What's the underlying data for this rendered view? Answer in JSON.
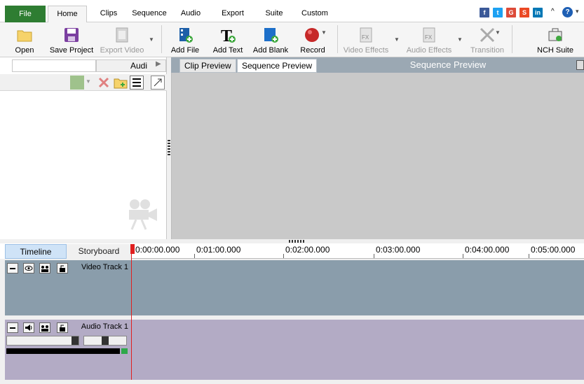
{
  "menu": {
    "tabs": [
      "File",
      "Home",
      "Clips",
      "Sequence",
      "Audio",
      "Export",
      "Suite",
      "Custom"
    ],
    "social": [
      {
        "name": "facebook",
        "glyph": "f",
        "color": "#3b5998"
      },
      {
        "name": "twitter",
        "glyph": "t",
        "color": "#1da1f2"
      },
      {
        "name": "google-plus",
        "glyph": "G",
        "color": "#dd4b39"
      },
      {
        "name": "stumbleupon",
        "glyph": "S",
        "color": "#eb4924"
      },
      {
        "name": "linkedin",
        "glyph": "in",
        "color": "#0077b5"
      }
    ],
    "collapse_glyph": "^",
    "help_glyph": "?",
    "help_dropdown_glyph": "▾"
  },
  "toolbar": {
    "open": "Open",
    "save_project": "Save Project",
    "export_video": "Export Video",
    "add_file": "Add File",
    "add_text": "Add Text",
    "add_blank": "Add Blank",
    "record": "Record",
    "video_effects": "Video Effects",
    "audio_effects": "Audio Effects",
    "transition": "Transition",
    "nch_suite": "NCH Suite"
  },
  "left_panel": {
    "tab_label": "Audi",
    "search_value": ""
  },
  "preview": {
    "clip_tab": "Clip Preview",
    "sequence_tab": "Sequence Preview",
    "title": "Sequence Preview"
  },
  "timeline": {
    "tab_timeline": "Timeline",
    "tab_storyboard": "Storyboard",
    "ruler": [
      "0:00:00.000",
      "0:01:00.000",
      "0:02:00.000",
      "0:03:00.000",
      "0:04:00.000",
      "0:05:00.000"
    ],
    "video_track": "Video Track 1",
    "audio_track": "Audio Track 1"
  },
  "colors": {
    "file_tab": "#2e7d32",
    "video_track": "#8a9dab",
    "audio_track": "#b3abc5",
    "playhead": "#e02020"
  }
}
